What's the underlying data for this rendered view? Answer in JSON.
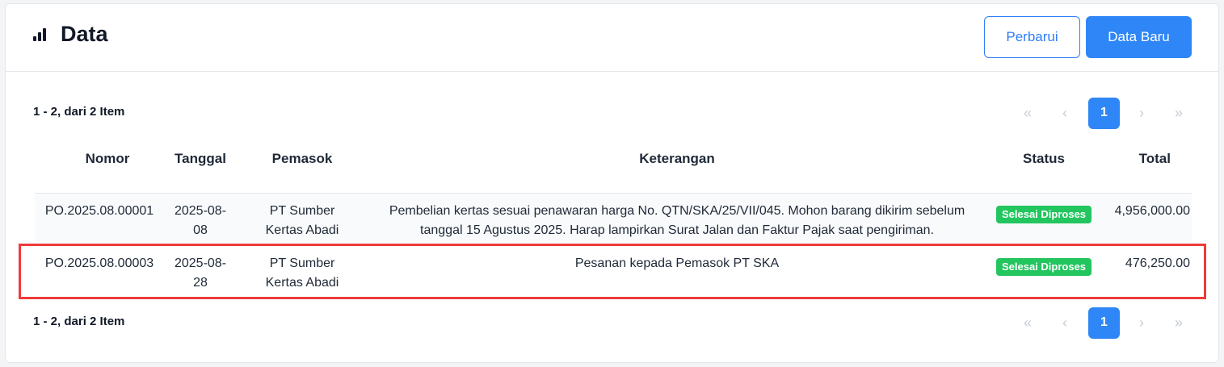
{
  "header": {
    "title": "Data",
    "refresh_label": "Perbarui",
    "new_label": "Data Baru"
  },
  "summary": "1 - 2, dari 2 Item",
  "pagination": {
    "first": "«",
    "prev": "‹",
    "current": "1",
    "next": "›",
    "last": "»"
  },
  "table": {
    "columns": [
      "Nomor",
      "Tanggal",
      "Pemasok",
      "Keterangan",
      "Status",
      "Total"
    ],
    "rows": [
      {
        "nomor": "PO.2025.08.00001",
        "tanggal": "2025-08-08",
        "pemasok": "PT Sumber Kertas Abadi",
        "keterangan": "Pembelian kertas sesuai penawaran harga No. QTN/SKA/25/VII/045. Mohon barang dikirim sebelum tanggal 15 Agustus 2025. Harap lampirkan Surat Jalan dan Faktur Pajak saat pengiriman.",
        "status": "Selesai Diproses",
        "total": "4,956,000.00"
      },
      {
        "nomor": "PO.2025.08.00003",
        "tanggal": "2025-08-28",
        "pemasok": "PT Sumber Kertas Abadi",
        "keterangan": "Pesanan kepada Pemasok PT SKA",
        "status": "Selesai Diproses",
        "total": "476,250.00"
      }
    ]
  },
  "icons": {
    "title_icon": "bar-chart-icon"
  },
  "colors": {
    "primary": "#2f86f6",
    "success": "#22c55e",
    "highlight": "#ef3b3b"
  }
}
